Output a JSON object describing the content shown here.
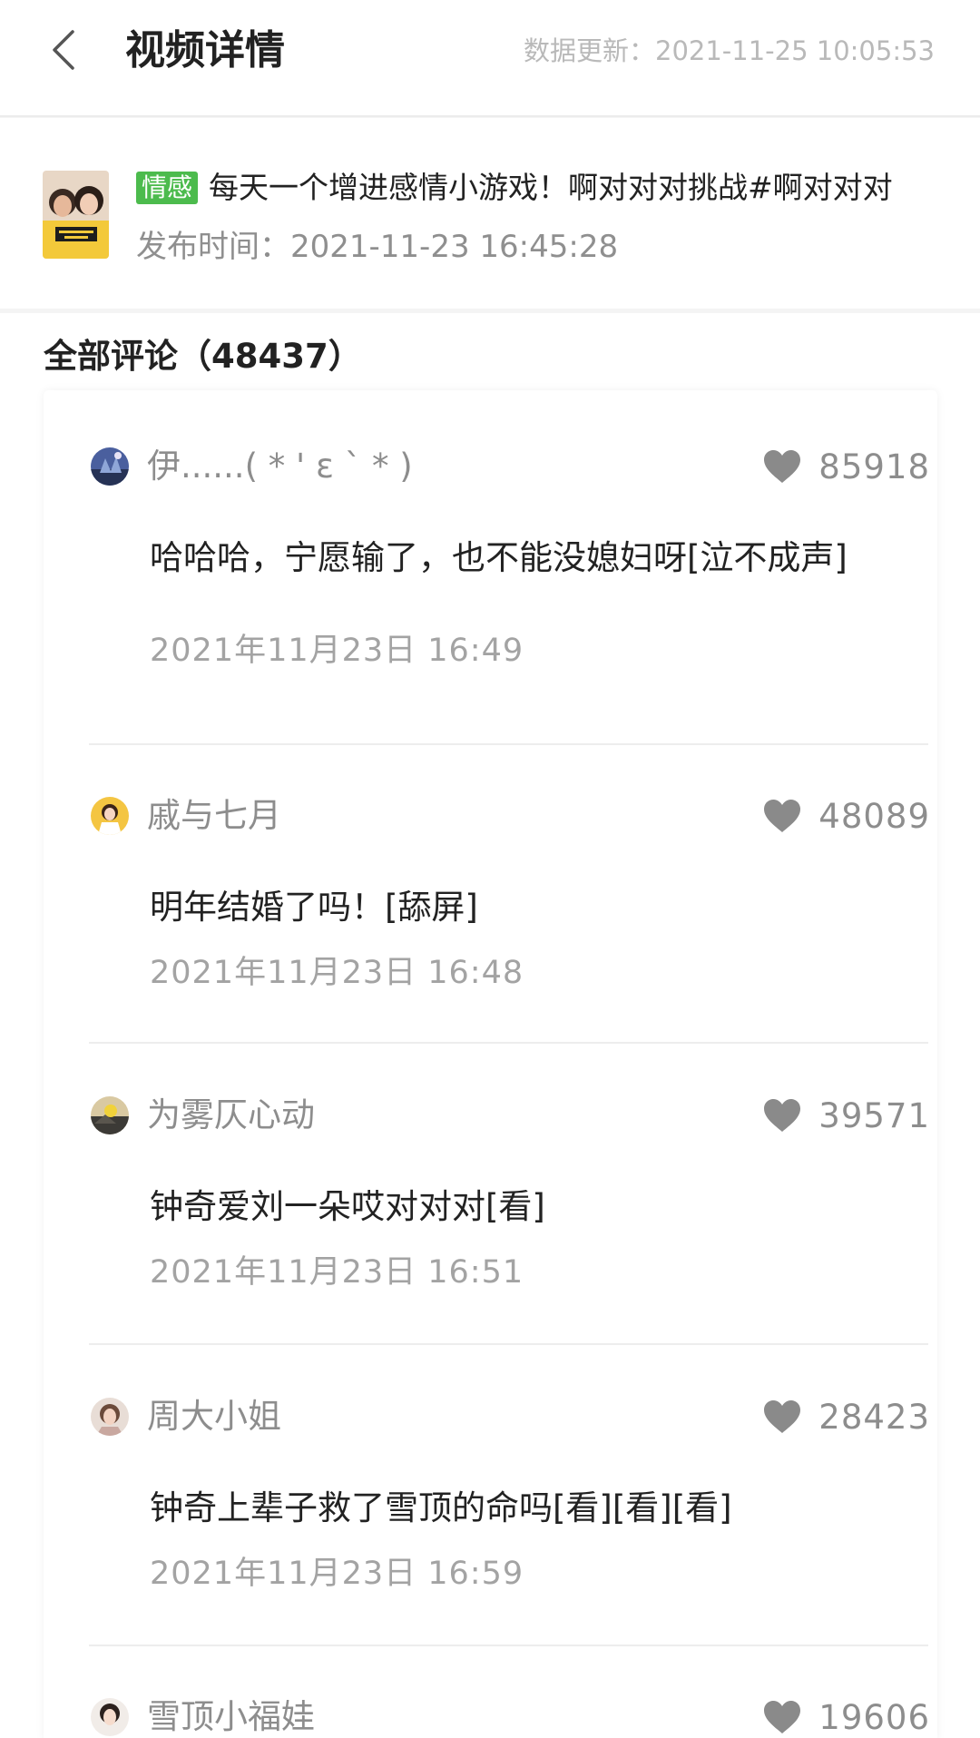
{
  "header": {
    "title": "视频详情",
    "update_text": "数据更新：2021-11-25 10:05:53"
  },
  "video": {
    "tag": "情感",
    "title": "每天一个增进感情小游戏！啊对对对挑战#啊对对对",
    "publish_text": "发布时间：2021-11-23 16:45:28"
  },
  "comments_section": {
    "title": "全部评论（48437）"
  },
  "comments": [
    {
      "user": "伊......( * ' ε ` * )",
      "likes": "85918",
      "text": "哈哈哈，宁愿输了，也不能没媳妇呀[泣不成声]",
      "time": "2021年11月23日  16:49"
    },
    {
      "user": "戚与七月",
      "likes": "48089",
      "text": "明年结婚了吗！[舔屏]",
      "time": "2021年11月23日  16:48"
    },
    {
      "user": "为雾仄心动",
      "likes": "39571",
      "text": "钟奇爱刘一朵哎对对对[看]",
      "time": "2021年11月23日  16:51"
    },
    {
      "user": "周大小姐",
      "likes": "28423",
      "text": "钟奇上辈子救了雪顶的命吗[看][看][看]",
      "time": "2021年11月23日  16:59"
    },
    {
      "user": "雪顶小福娃",
      "likes": "19606",
      "text": "",
      "time": ""
    }
  ],
  "colors": {
    "tag_green": "#4cbb4d",
    "muted_text": "#8d8d8d",
    "heart_gray": "#8a8a8a"
  }
}
